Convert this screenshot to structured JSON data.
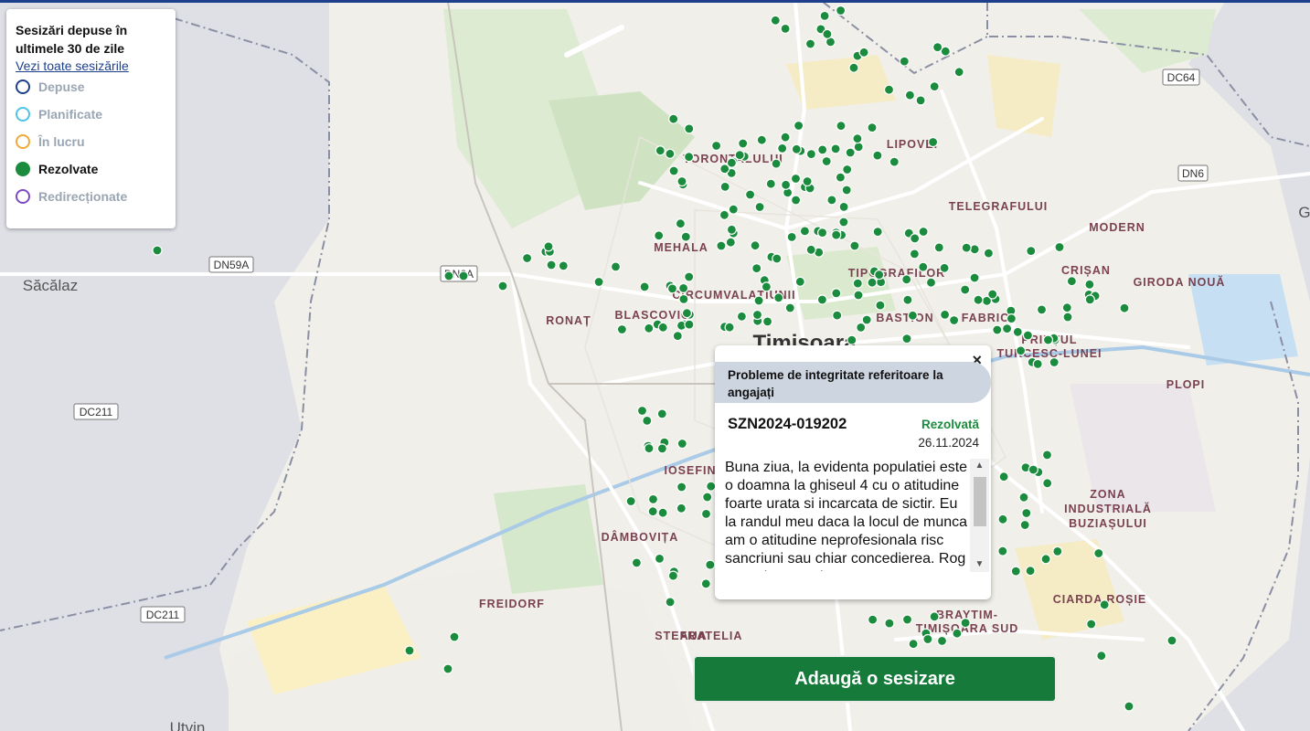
{
  "legend": {
    "title": "Sesizări depuse în ultimele 30 de zile",
    "link": "Vezi toate sesizările",
    "items": [
      {
        "label": "Depuse",
        "color": "#1d3f8c",
        "active": false
      },
      {
        "label": "Planificate",
        "color": "#4ec4e8",
        "active": false
      },
      {
        "label": "În lucru",
        "color": "#f0a93a",
        "active": false
      },
      {
        "label": "Rezolvate",
        "color": "#1b8c3d",
        "active": true
      },
      {
        "label": "Redirecționate",
        "color": "#7b4bc4",
        "active": false
      }
    ]
  },
  "map": {
    "places": [
      "Săcălaz",
      "TORONTALULUI",
      "LIPOVEI",
      "TELEGRAFULUI",
      "MODERN",
      "MEHALA",
      "IOSEFIN",
      "FRATELIA",
      "TIPOGRAFILOR",
      "CRIȘAN",
      "CIRCUMVALAȚIUNII",
      "BASTION",
      "FABRIC",
      "RONAȚ",
      "BLASCOVICI",
      "PRINȚUL TURCESC-LUNEI",
      "PLOPI",
      "ZONA INDUSTRIALĂ BUZIAȘULUI",
      "DÂMBOVIȚA",
      "FREIDORF",
      "STEAUA",
      "BRAYTIM-TIMIȘOARA SUD",
      "CIARDA ROȘIE",
      "GIRODA NOUĂ",
      "Timișoara",
      "Utvin",
      "G"
    ],
    "roads": [
      "DC64",
      "DN6",
      "DN59A",
      "DN6A",
      "DC211",
      "DC211"
    ],
    "marker_color": "#1b8c3d"
  },
  "popup": {
    "close": "×",
    "category": "Probleme de integritate referitoare la angajați",
    "id": "SZN2024-019202",
    "status": "Rezolvată",
    "date": "26.11.2024",
    "text": "Buna ziua, la evidenta populatiei este o doamna la ghiseul 4 cu o atitudine foarte urata si incarcata de sictir. Eu la randul meu daca la locul de munca am o atitudine neprofesionala risc sancriuni sau chiar concedierea. Rog sa se ia masuri.",
    "scroll_up": "▲",
    "scroll_down": "▼"
  },
  "actions": {
    "add": "Adaugă o sesizare"
  }
}
